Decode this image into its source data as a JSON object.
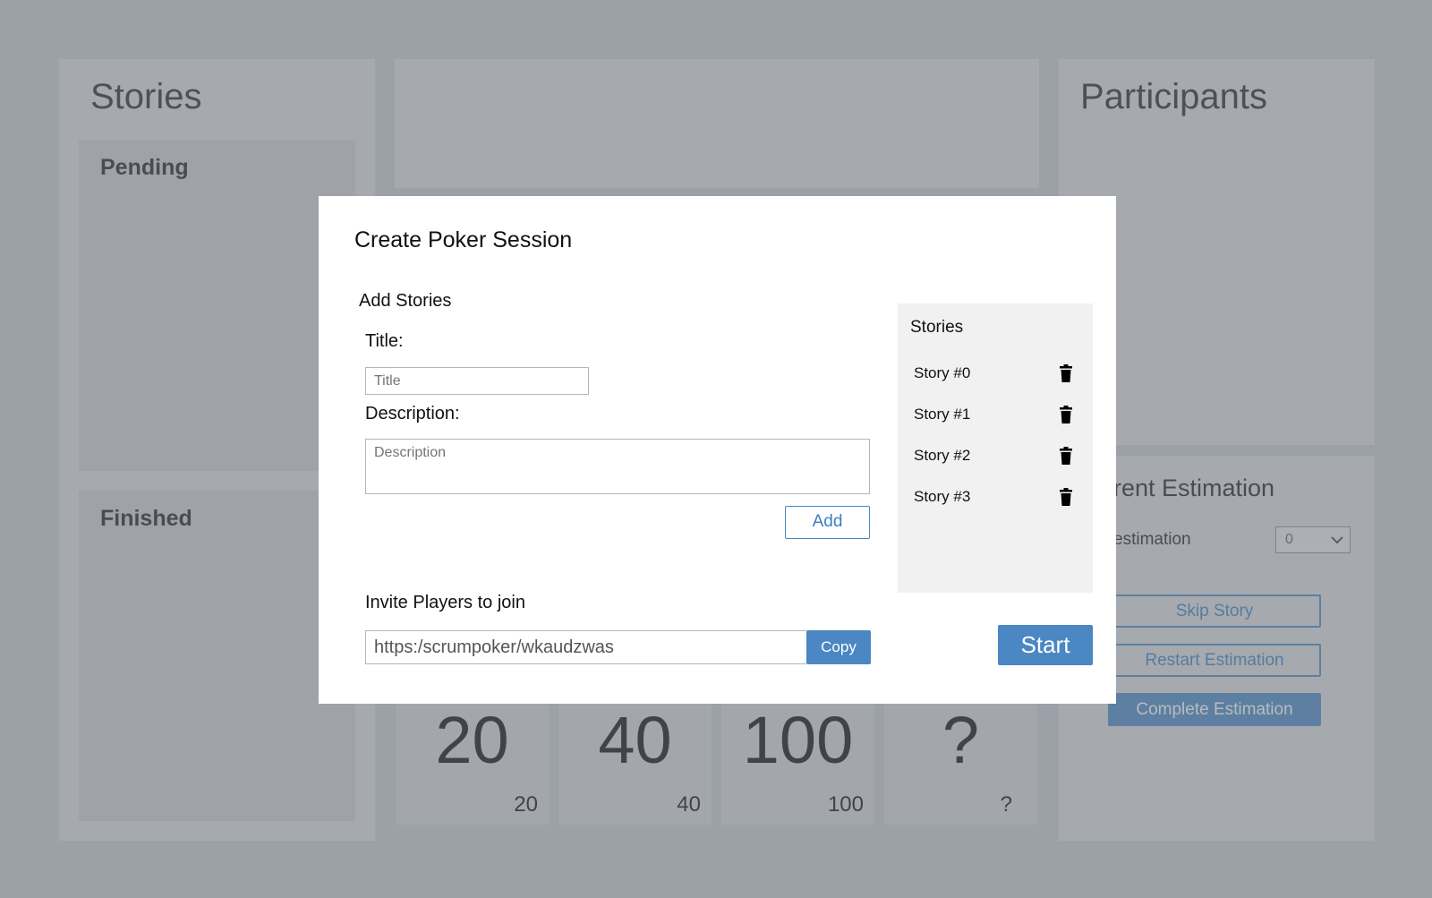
{
  "background": {
    "stories_panel": {
      "title": "Stories",
      "pending_label": "Pending",
      "finished_label": "Finished"
    },
    "participants_panel": {
      "title": "Participants"
    },
    "estimation_panel": {
      "title": "rent Estimation",
      "estimation_label": "estimation",
      "select_value": "0",
      "skip_label": "Skip Story",
      "restart_label": "Restart Estimation",
      "complete_label": "Complete Estimation"
    },
    "cards": [
      {
        "big": "20",
        "small": "20"
      },
      {
        "big": "40",
        "small": "40"
      },
      {
        "big": "100",
        "small": "100"
      },
      {
        "big": "?",
        "small": "?"
      }
    ]
  },
  "modal": {
    "title": "Create Poker Session",
    "add_stories_label": "Add Stories",
    "title_label": "Title:",
    "title_placeholder": "Title",
    "description_label": "Description:",
    "description_placeholder": "Description",
    "add_button": "Add",
    "stories_header": "Stories",
    "stories": [
      "Story #0",
      "Story #1",
      "Story #2",
      "Story #3"
    ],
    "invite_label": "Invite Players to join",
    "invite_link": "https:/scrumpoker/wkaudzwas",
    "copy_button": "Copy",
    "start_button": "Start"
  },
  "colors": {
    "accent": "#4a87c3"
  }
}
